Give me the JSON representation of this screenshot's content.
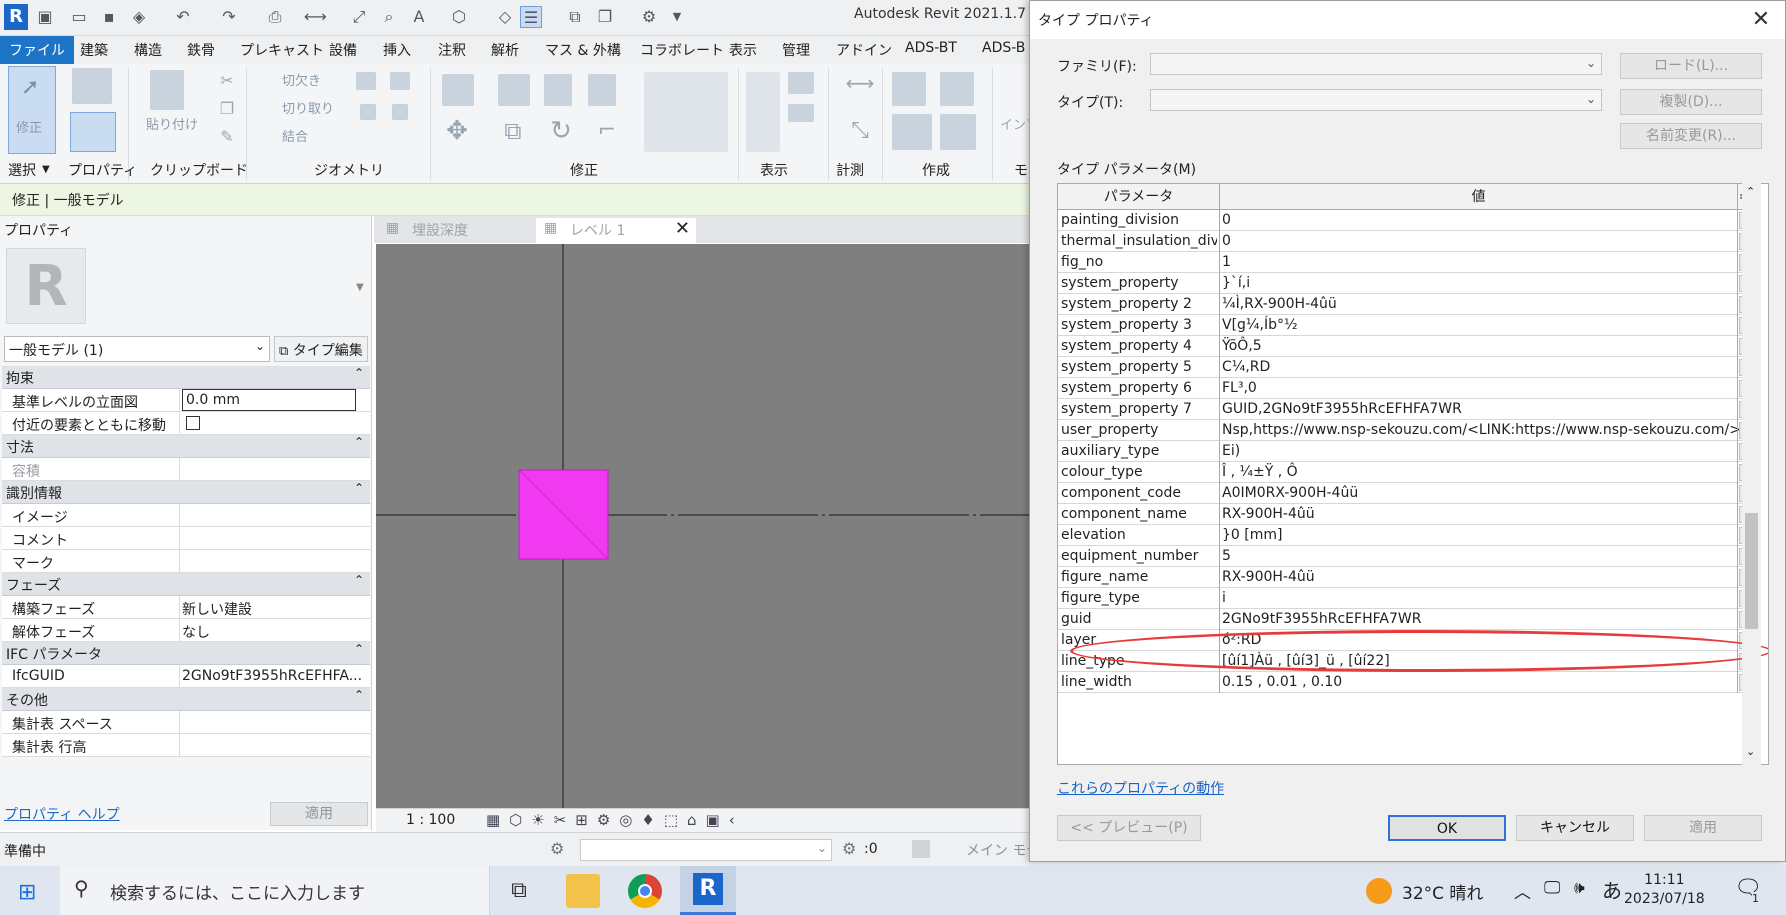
{
  "app": {
    "title": "Autodesk Revit 2021.1.7 -"
  },
  "menu_tabs": [
    "ファイル",
    "建築",
    "構造",
    "鉄骨",
    "プレキャスト",
    "設備",
    "挿入",
    "注釈",
    "解析",
    "マス & 外構",
    "コラボレート",
    "表示",
    "管理",
    "アドイン",
    "ADS-BT",
    "ADS-B"
  ],
  "ribbon": {
    "modify_label": "修正",
    "paste_label": "貼り付け",
    "cut_label": "切欠き",
    "cut_geom_label": "切り取り",
    "join_label": "結合",
    "groups": [
      "選択",
      "プロパティ",
      "クリップボード",
      "ジオメトリ",
      "修正",
      "表示",
      "計測",
      "作成",
      "モ"
    ],
    "infra_label": "インフ"
  },
  "context": {
    "text": "修正 | 一般モデル"
  },
  "properties": {
    "title": "プロパティ",
    "type_selector": "一般モデル (1)",
    "type_edit": "タイプ編集",
    "help": "プロパティ ヘルプ",
    "apply": "適用",
    "sections": [
      {
        "name": "拘束",
        "rows": [
          {
            "k": "基準レベルの立面図",
            "v": "0.0 mm"
          },
          {
            "k": "付近の要素とともに移動",
            "v": ""
          }
        ]
      },
      {
        "name": "寸法",
        "rows": [
          {
            "k": "容積",
            "v": ""
          }
        ]
      },
      {
        "name": "識別情報",
        "rows": [
          {
            "k": "イメージ",
            "v": ""
          },
          {
            "k": "コメント",
            "v": ""
          },
          {
            "k": "マーク",
            "v": ""
          }
        ]
      },
      {
        "name": "フェーズ",
        "rows": [
          {
            "k": "構築フェーズ",
            "v": "新しい建設"
          },
          {
            "k": "解体フェーズ",
            "v": "なし"
          }
        ]
      },
      {
        "name": "IFC パラメータ",
        "rows": [
          {
            "k": "IfcGUID",
            "v": "2GNo9tF3955hRcEFHFA..."
          }
        ]
      },
      {
        "name": "その他",
        "rows": [
          {
            "k": "集計表 スペース",
            "v": ""
          },
          {
            "k": "集計表 行高",
            "v": ""
          }
        ]
      }
    ]
  },
  "view_tabs": [
    {
      "label": "埋設深度"
    },
    {
      "label": "レベル 1"
    }
  ],
  "view_bar": {
    "scale": "1 : 100"
  },
  "status": {
    "text": "準備中",
    "count": ":0",
    "model": "メイン モデ"
  },
  "taskbar": {
    "search_placeholder": "検索するには、ここに入力します",
    "weather": "32°C 晴れ",
    "ime": "あ",
    "time": "11:11",
    "date": "2023/07/18",
    "notif_count": "1"
  },
  "dialog": {
    "title": "タイプ プロパティ",
    "family_label": "ファミリ(F):",
    "type_label": "タイプ(T):",
    "load_btn": "ロード(L)...",
    "dup_btn": "複製(D)...",
    "rename_btn": "名前変更(R)...",
    "params_label": "タイプ パラメータ(M)",
    "col_param": "パラメータ",
    "col_value": "値",
    "col_eq": "=",
    "rows": [
      {
        "p": "painting_division",
        "v": "0"
      },
      {
        "p": "thermal_insulation_divis",
        "v": "0"
      },
      {
        "p": "fig_no",
        "v": "1"
      },
      {
        "p": "system_property",
        "v": "}`í,i"
      },
      {
        "p": "system_property 2",
        "v": "¼Ì,RX-900H-4ûü"
      },
      {
        "p": "system_property 3",
        "v": "V[g¼,Íb°½"
      },
      {
        "p": "system_property 4",
        "v": "ŸõÔ,5"
      },
      {
        "p": "system_property 5",
        "v": "C¼,RD"
      },
      {
        "p": "system_property 6",
        "v": "FL³,0"
      },
      {
        "p": "system_property 7",
        "v": "GUID,2GNo9tF3955hRcEFHFA7WR"
      },
      {
        "p": "user_property",
        "v": "Nsp,https://www.nsp-sekouzu.com/<LINK:https://www.nsp-sekouzu.com/>"
      },
      {
        "p": "auxiliary_type",
        "v": "Ei)"
      },
      {
        "p": "colour_type",
        "v": "Î , ¼±Ÿ , Ô"
      },
      {
        "p": "component_code",
        "v": "A0IM0RX-900H-4ûü"
      },
      {
        "p": "component_name",
        "v": "RX-900H-4ûü"
      },
      {
        "p": "elevation",
        "v": "}0 [mm]"
      },
      {
        "p": "equipment_number",
        "v": "5"
      },
      {
        "p": "figure_name",
        "v": "RX-900H-4ûü"
      },
      {
        "p": "figure_type",
        "v": "i"
      },
      {
        "p": "guid",
        "v": "2GNo9tF3955hRcEFHFA7WR"
      },
      {
        "p": "layer",
        "v": "ó²:RD"
      },
      {
        "p": "line_type",
        "v": "[ûí1]Àü , [ûí3]_ü , [ûí22]"
      },
      {
        "p": "line_width",
        "v": "0.15 , 0.01 , 0.10"
      }
    ],
    "link": "これらのプロパティの動作",
    "preview_btn": "<< プレビュー(P)",
    "ok_btn": "OK",
    "cancel_btn": "キャンセル",
    "apply_btn": "適用"
  }
}
